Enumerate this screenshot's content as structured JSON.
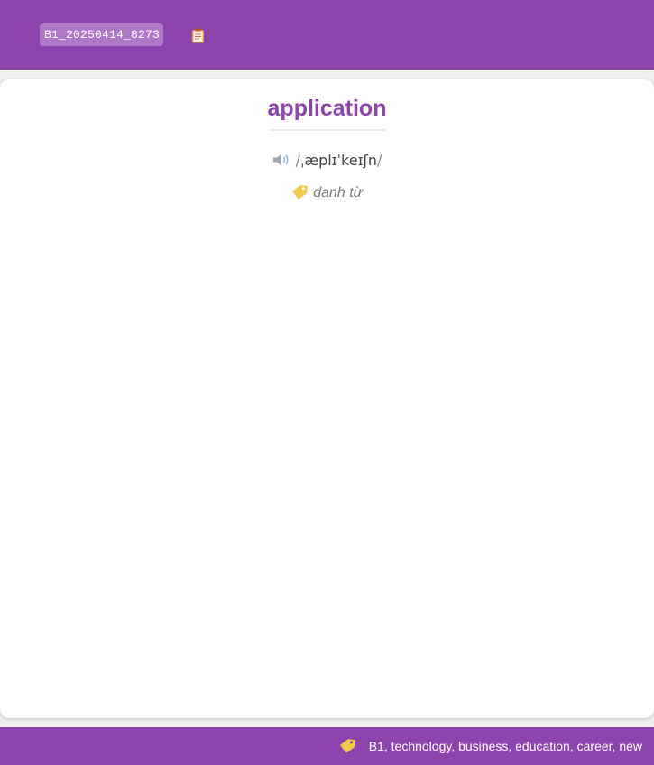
{
  "header": {
    "card_id": "B1_20250414_8273",
    "copy_icon": "clipboard-icon",
    "background": "#8e44ad"
  },
  "card": {
    "word": "application",
    "pronunciation": {
      "audio_icon": "speaker-icon",
      "ipa": "ˌæplɪˈkeɪʃn"
    },
    "part_of_speech": {
      "icon": "tag-icon",
      "label": "danh từ"
    },
    "accent_color": "#8e44ad"
  },
  "footer": {
    "icon": "tag-icon",
    "tags": "B1, technology, business, education, career, new"
  }
}
